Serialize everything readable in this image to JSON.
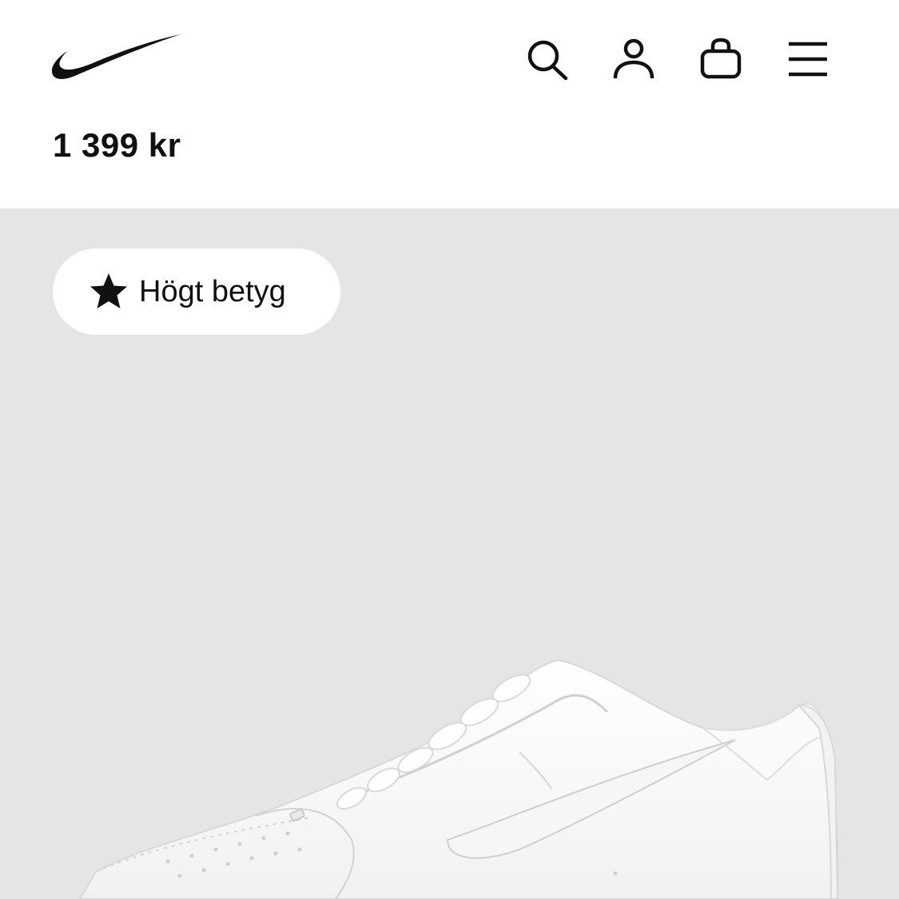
{
  "header": {
    "logo": {
      "icon": "nike-swoosh-icon",
      "color": "#111111"
    },
    "actions": [
      {
        "icon": "search-icon"
      },
      {
        "icon": "user-icon"
      },
      {
        "icon": "bag-icon"
      },
      {
        "icon": "menu-icon"
      }
    ]
  },
  "product": {
    "price": "1 399 kr",
    "badge": {
      "icon": "star-icon",
      "label": "Högt betyg"
    },
    "image": {
      "background": "#e5e5e5",
      "shoe_color": "#ffffff"
    }
  }
}
